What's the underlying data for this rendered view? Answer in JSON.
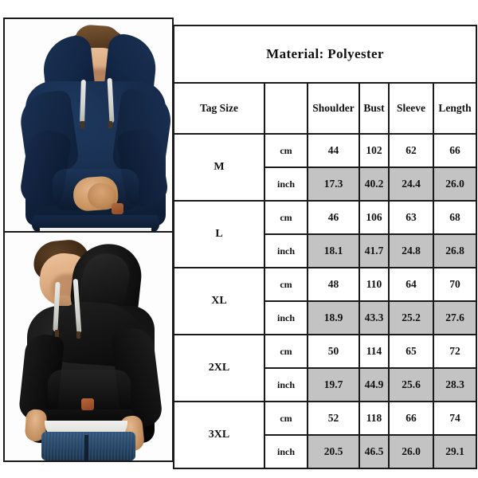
{
  "table": {
    "title": "Material:  Polyester",
    "headers": {
      "tag_size": "Tag Size",
      "unit": "",
      "shoulder": "Shoulder",
      "bust": "Bust",
      "sleeve": "Sleeve",
      "length": "Length"
    },
    "unit_labels": {
      "cm": "cm",
      "inch": "inch"
    },
    "rows": [
      {
        "size": "M",
        "cm": {
          "shoulder": "44",
          "bust": "102",
          "sleeve": "62",
          "length": "66"
        },
        "inch": {
          "shoulder": "17.3",
          "bust": "40.2",
          "sleeve": "24.4",
          "length": "26.0"
        }
      },
      {
        "size": "L",
        "cm": {
          "shoulder": "46",
          "bust": "106",
          "sleeve": "63",
          "length": "68"
        },
        "inch": {
          "shoulder": "18.1",
          "bust": "41.7",
          "sleeve": "24.8",
          "length": "26.8"
        }
      },
      {
        "size": "XL",
        "cm": {
          "shoulder": "48",
          "bust": "110",
          "sleeve": "64",
          "length": "70"
        },
        "inch": {
          "shoulder": "18.9",
          "bust": "43.3",
          "sleeve": "25.2",
          "length": "27.6"
        }
      },
      {
        "size": "2XL",
        "cm": {
          "shoulder": "50",
          "bust": "114",
          "sleeve": "65",
          "length": "72"
        },
        "inch": {
          "shoulder": "19.7",
          "bust": "44.9",
          "sleeve": "25.6",
          "length": "28.3"
        }
      },
      {
        "size": "3XL",
        "cm": {
          "shoulder": "52",
          "bust": "118",
          "sleeve": "66",
          "length": "74"
        },
        "inch": {
          "shoulder": "20.5",
          "bust": "46.5",
          "sleeve": "26.0",
          "length": "29.1"
        }
      }
    ]
  },
  "photos": [
    {
      "id": "photo-navy-hoodie",
      "description": "Man wearing navy blue pullover hoodie, head bowed, hands clasped in front",
      "garment_color": "#12294a",
      "drawstring_color": "#e0e0dc",
      "patch_color": "#9a5530"
    },
    {
      "id": "photo-black-hoodie",
      "description": "Man wearing black pullover hoodie in three-quarter view with blue jeans",
      "garment_color": "#0d0d0d",
      "drawstring_color": "#e0e0dc",
      "patch_color": "#a8502a",
      "jeans_color": "#28496b"
    }
  ],
  "colors": {
    "page_background": "#ffffff",
    "border": "#1a1a1a",
    "inch_row_fill": "#c3c3c3",
    "text": "#111111"
  }
}
